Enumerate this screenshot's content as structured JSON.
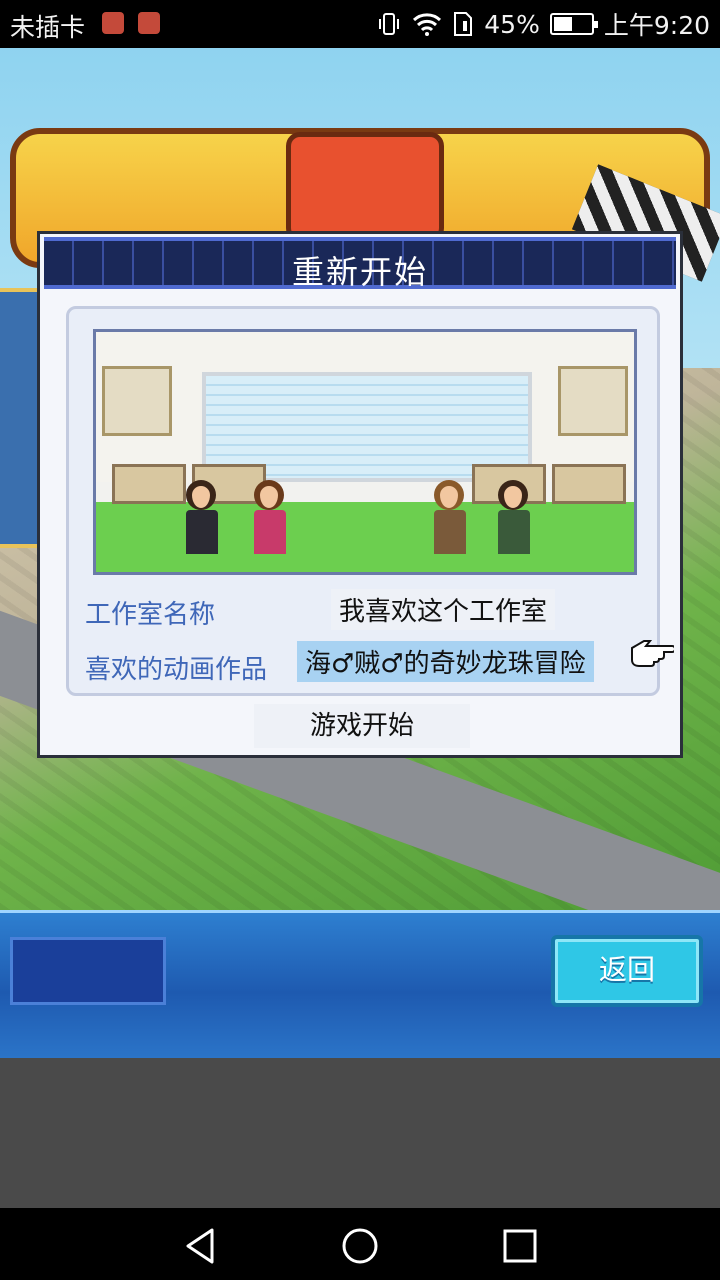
{
  "status_bar": {
    "carrier": "未插卡",
    "battery_percent": "45%",
    "time": "上午9:20"
  },
  "dialog": {
    "title": "重新开始",
    "studio_name_label": "工作室名称",
    "studio_name_value": "我喜欢这个工作室",
    "favorite_anime_label": "喜欢的动画作品",
    "favorite_anime_value": "海♂贼♂的奇妙龙珠冒险",
    "start_label": "游戏开始"
  },
  "bottom_panel": {
    "back_label": "返回"
  },
  "colors": {
    "label_blue": "#3f67b8",
    "selected_bg": "#a8d2f2",
    "header_navy": "#1f2f6a",
    "back_button": "#2fc7e6"
  },
  "icons": [
    "wifi-icon",
    "battery-icon",
    "vibrate-icon",
    "pointer-hand-icon",
    "nav-back-icon",
    "nav-home-icon",
    "nav-recent-icon"
  ]
}
